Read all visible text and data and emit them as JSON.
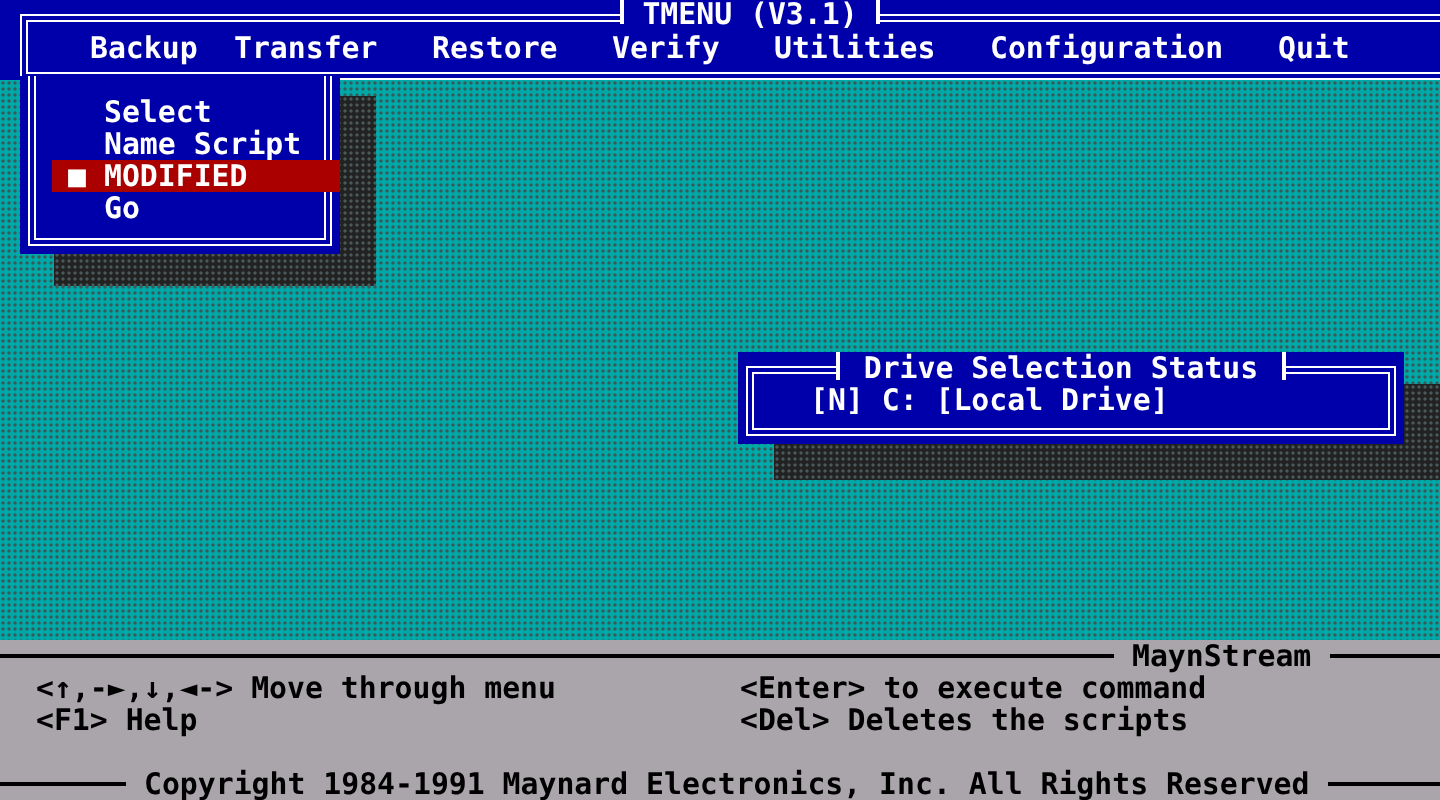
{
  "window": {
    "title": "TMENU (V3.1)"
  },
  "menu_bar": [
    {
      "label": "Backup"
    },
    {
      "label": "Transfer"
    },
    {
      "label": "Restore"
    },
    {
      "label": "Verify"
    },
    {
      "label": "Utilities"
    },
    {
      "label": "Configuration"
    },
    {
      "label": "Quit"
    }
  ],
  "dropdown": {
    "items": [
      {
        "label": "Select",
        "selected": false
      },
      {
        "label": "Name Script",
        "selected": false
      },
      {
        "label": "MODIFIED",
        "selected": true,
        "marker": "■"
      },
      {
        "label": "Go",
        "selected": false
      }
    ]
  },
  "drive_status": {
    "title": "Drive Selection Status",
    "lines": [
      "[N] C: [Local Drive]"
    ]
  },
  "footer": {
    "app_name": "MaynStream",
    "hints": [
      [
        "<↑,-►,↓,◄-> Move through menu",
        "<F1> Help"
      ],
      [
        "<Enter> to execute command",
        "<Del> Deletes the scripts"
      ]
    ],
    "copyright": "Copyright 1984-1991 Maynard Electronics, Inc. All Rights Reserved"
  }
}
